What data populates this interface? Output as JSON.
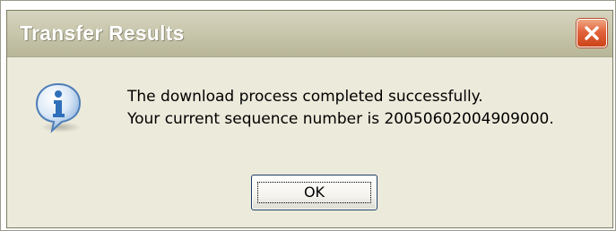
{
  "window": {
    "title": "Transfer Results",
    "close_icon": "close-icon"
  },
  "dialog": {
    "icon": "info-icon",
    "message_line1": "The download process completed successfully.",
    "message_line2": "Your current sequence number is 20050602004909000.",
    "ok_label": "OK"
  },
  "colors": {
    "titlebar": "#c6c4a9",
    "title_text": "#ffffff",
    "close_button": "#e2643c",
    "dialog_body": "#eceadb",
    "info_icon": "#2f6fba"
  }
}
